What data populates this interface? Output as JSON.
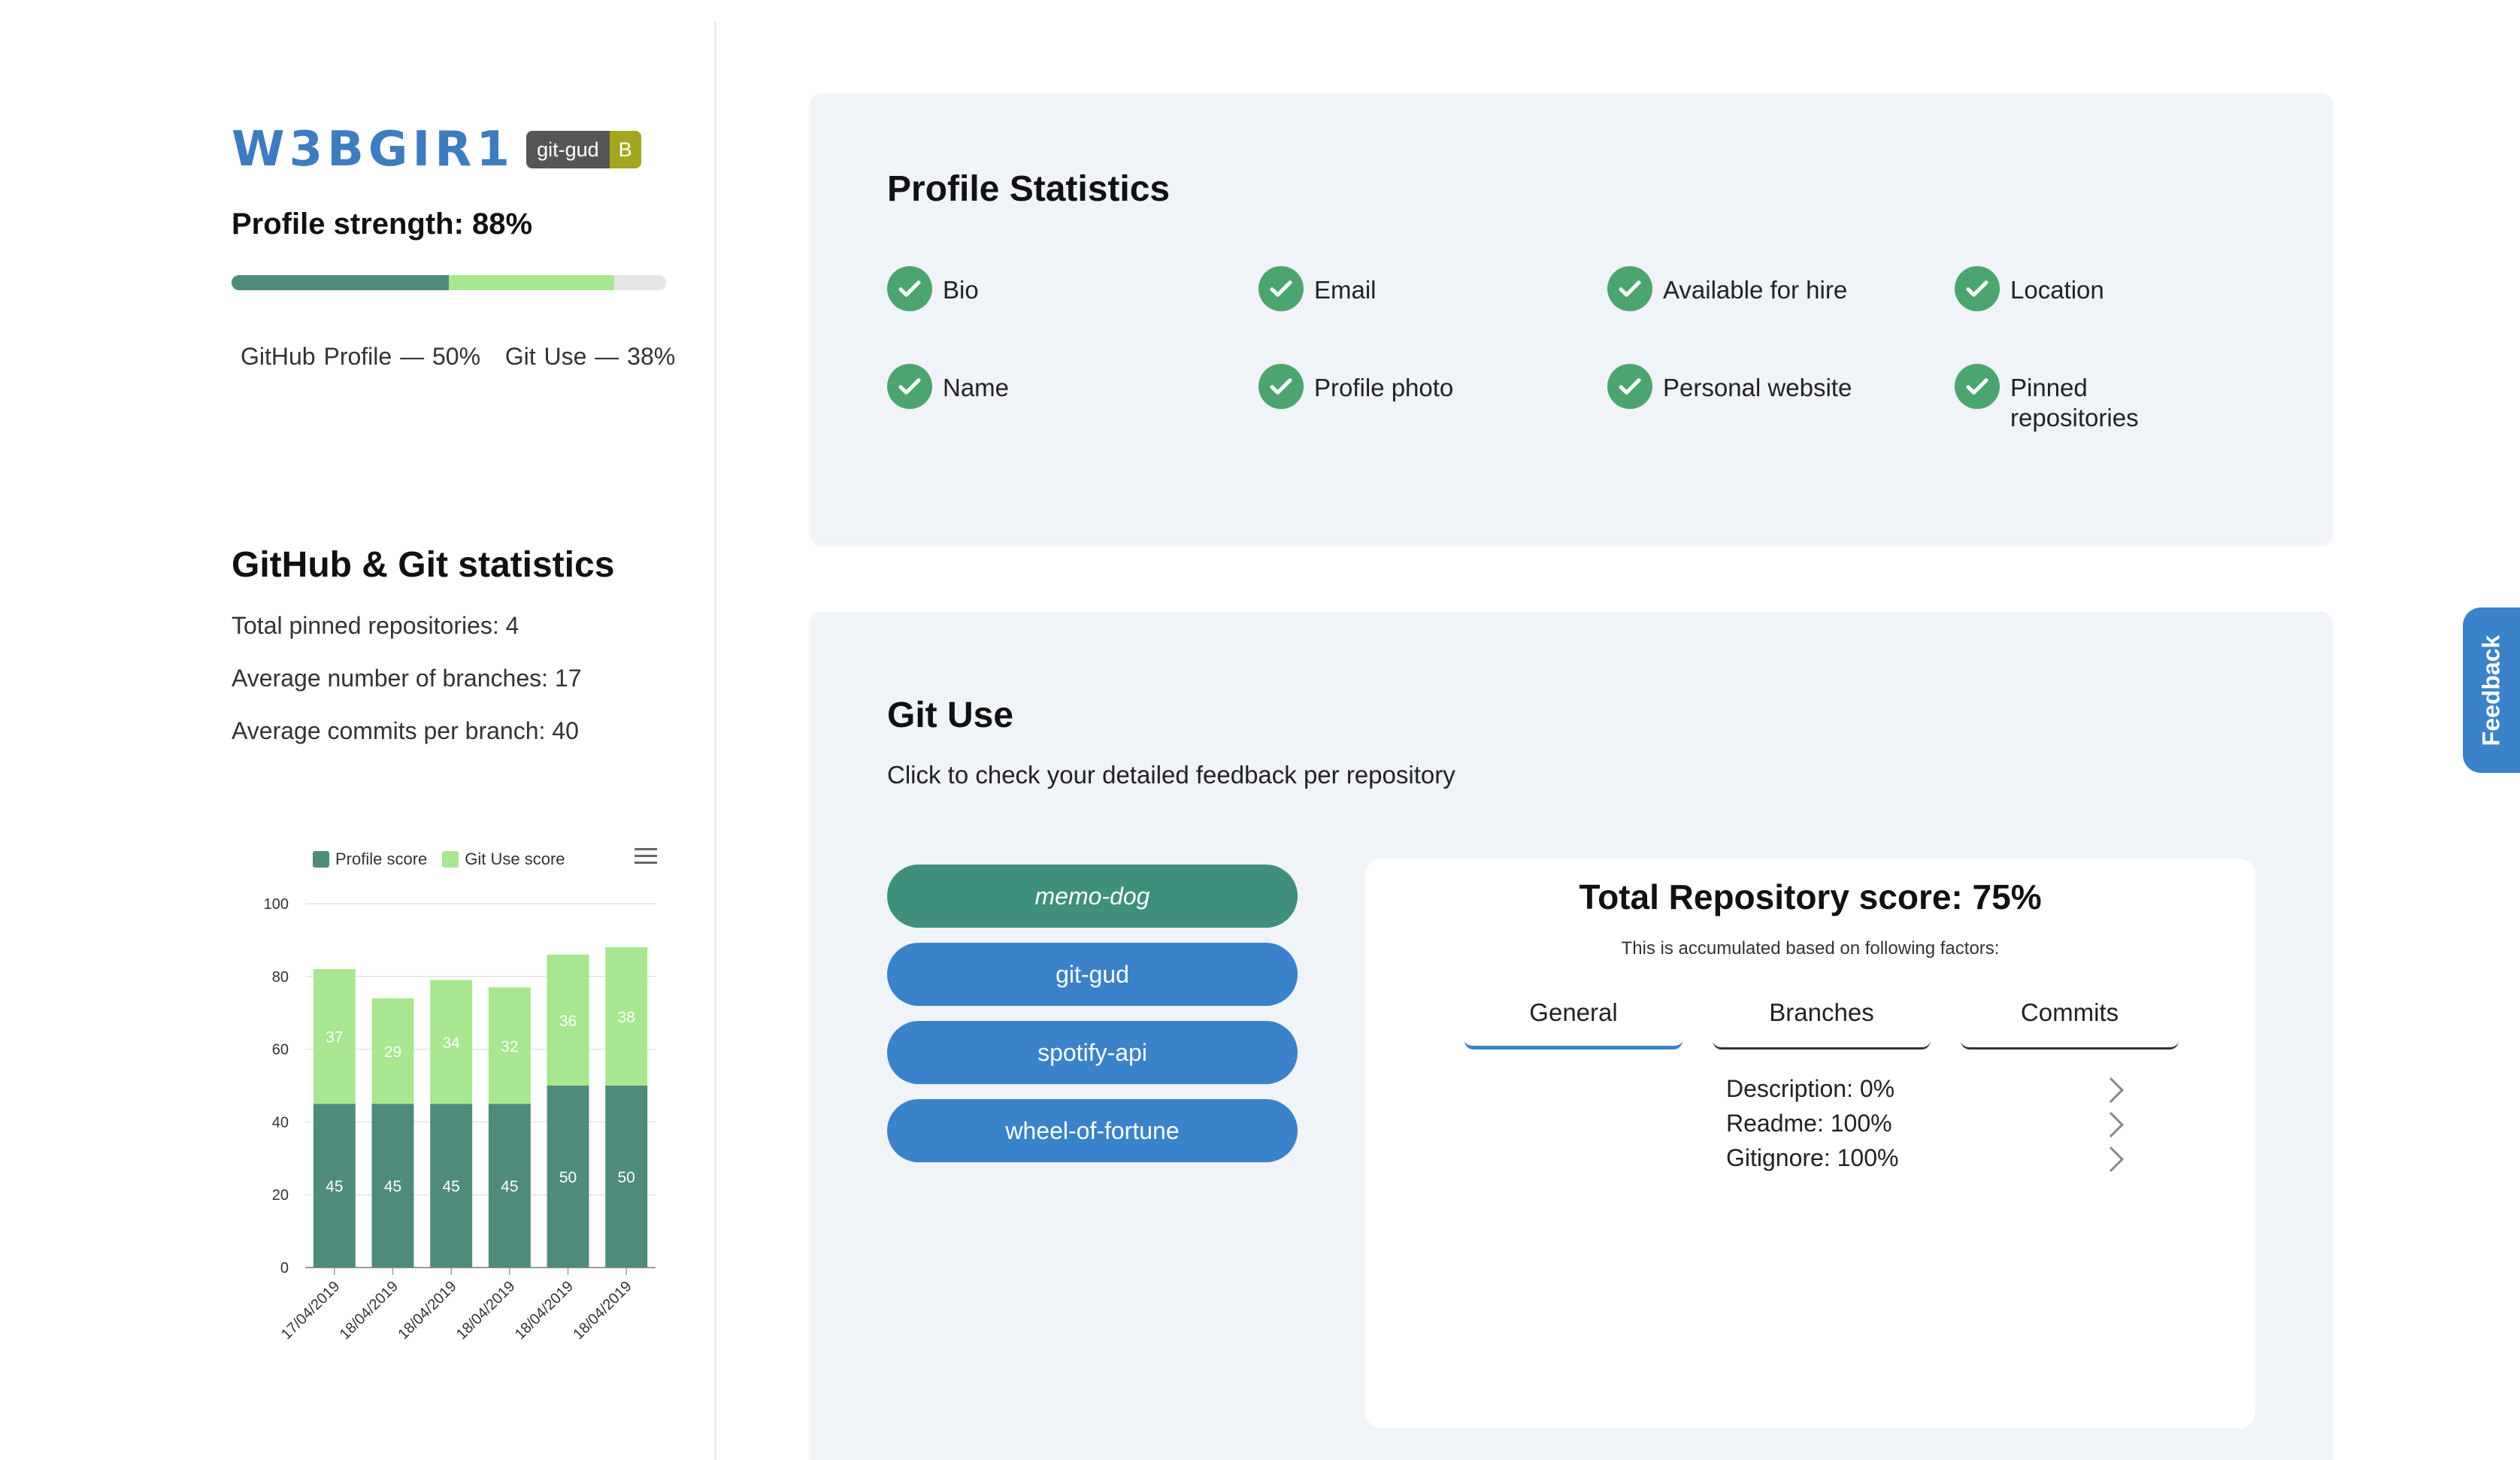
{
  "sidebar": {
    "logo": "W3BGIR1",
    "badge": {
      "left": "git-gud",
      "right": "B"
    },
    "strength_label": "Profile strength: 88%",
    "progress": {
      "github_fraction": 0.5,
      "gituse_fraction": 0.38
    },
    "bar_legend": "GitHub Profile — 50%   Git Use — 38%",
    "stats_title": "GitHub & Git statistics",
    "stats": [
      "Total pinned repositories: 4",
      "Average number of branches: 17",
      "Average commits per branch: 40"
    ]
  },
  "chart_data": {
    "type": "bar",
    "stacked": true,
    "categories": [
      "17/04/2019",
      "18/04/2019",
      "18/04/2019",
      "18/04/2019",
      "18/04/2019",
      "18/04/2019"
    ],
    "series": [
      {
        "name": "Profile score",
        "values": [
          45,
          45,
          45,
          45,
          50,
          50
        ],
        "color": "#4e8b7b"
      },
      {
        "name": "Git Use score",
        "values": [
          37,
          29,
          34,
          32,
          36,
          38
        ],
        "color": "#a8e68f"
      }
    ],
    "ylim": [
      0,
      100
    ],
    "yticks": [
      "0",
      "20",
      "40",
      "60",
      "80",
      "100"
    ],
    "legend_position": "top",
    "grid": true
  },
  "profile_statistics": {
    "title": "Profile Statistics",
    "items": [
      "Bio",
      "Email",
      "Available for hire",
      "Location",
      "Name",
      "Profile photo",
      "Personal website",
      "Pinned repositories"
    ]
  },
  "git_use": {
    "title": "Git Use",
    "subtitle": "Click to check your detailed feedback per repository",
    "repos": [
      "memo-dog",
      "git-gud",
      "spotify-api",
      "wheel-of-fortune"
    ],
    "score_title": "Total Repository score: 75%",
    "score_subtitle": "This is accumulated based on following factors:",
    "tabs": [
      "General",
      "Branches",
      "Commits"
    ],
    "factors": [
      "Description: 0%",
      "Readme: 100%",
      "Gitignore: 100%"
    ]
  },
  "feedback_label": "Feedback",
  "colors": {
    "accent": "#3a82c9",
    "dark_green": "#4e8b7b",
    "light_green": "#a8e68f",
    "check": "#4aa56e"
  }
}
